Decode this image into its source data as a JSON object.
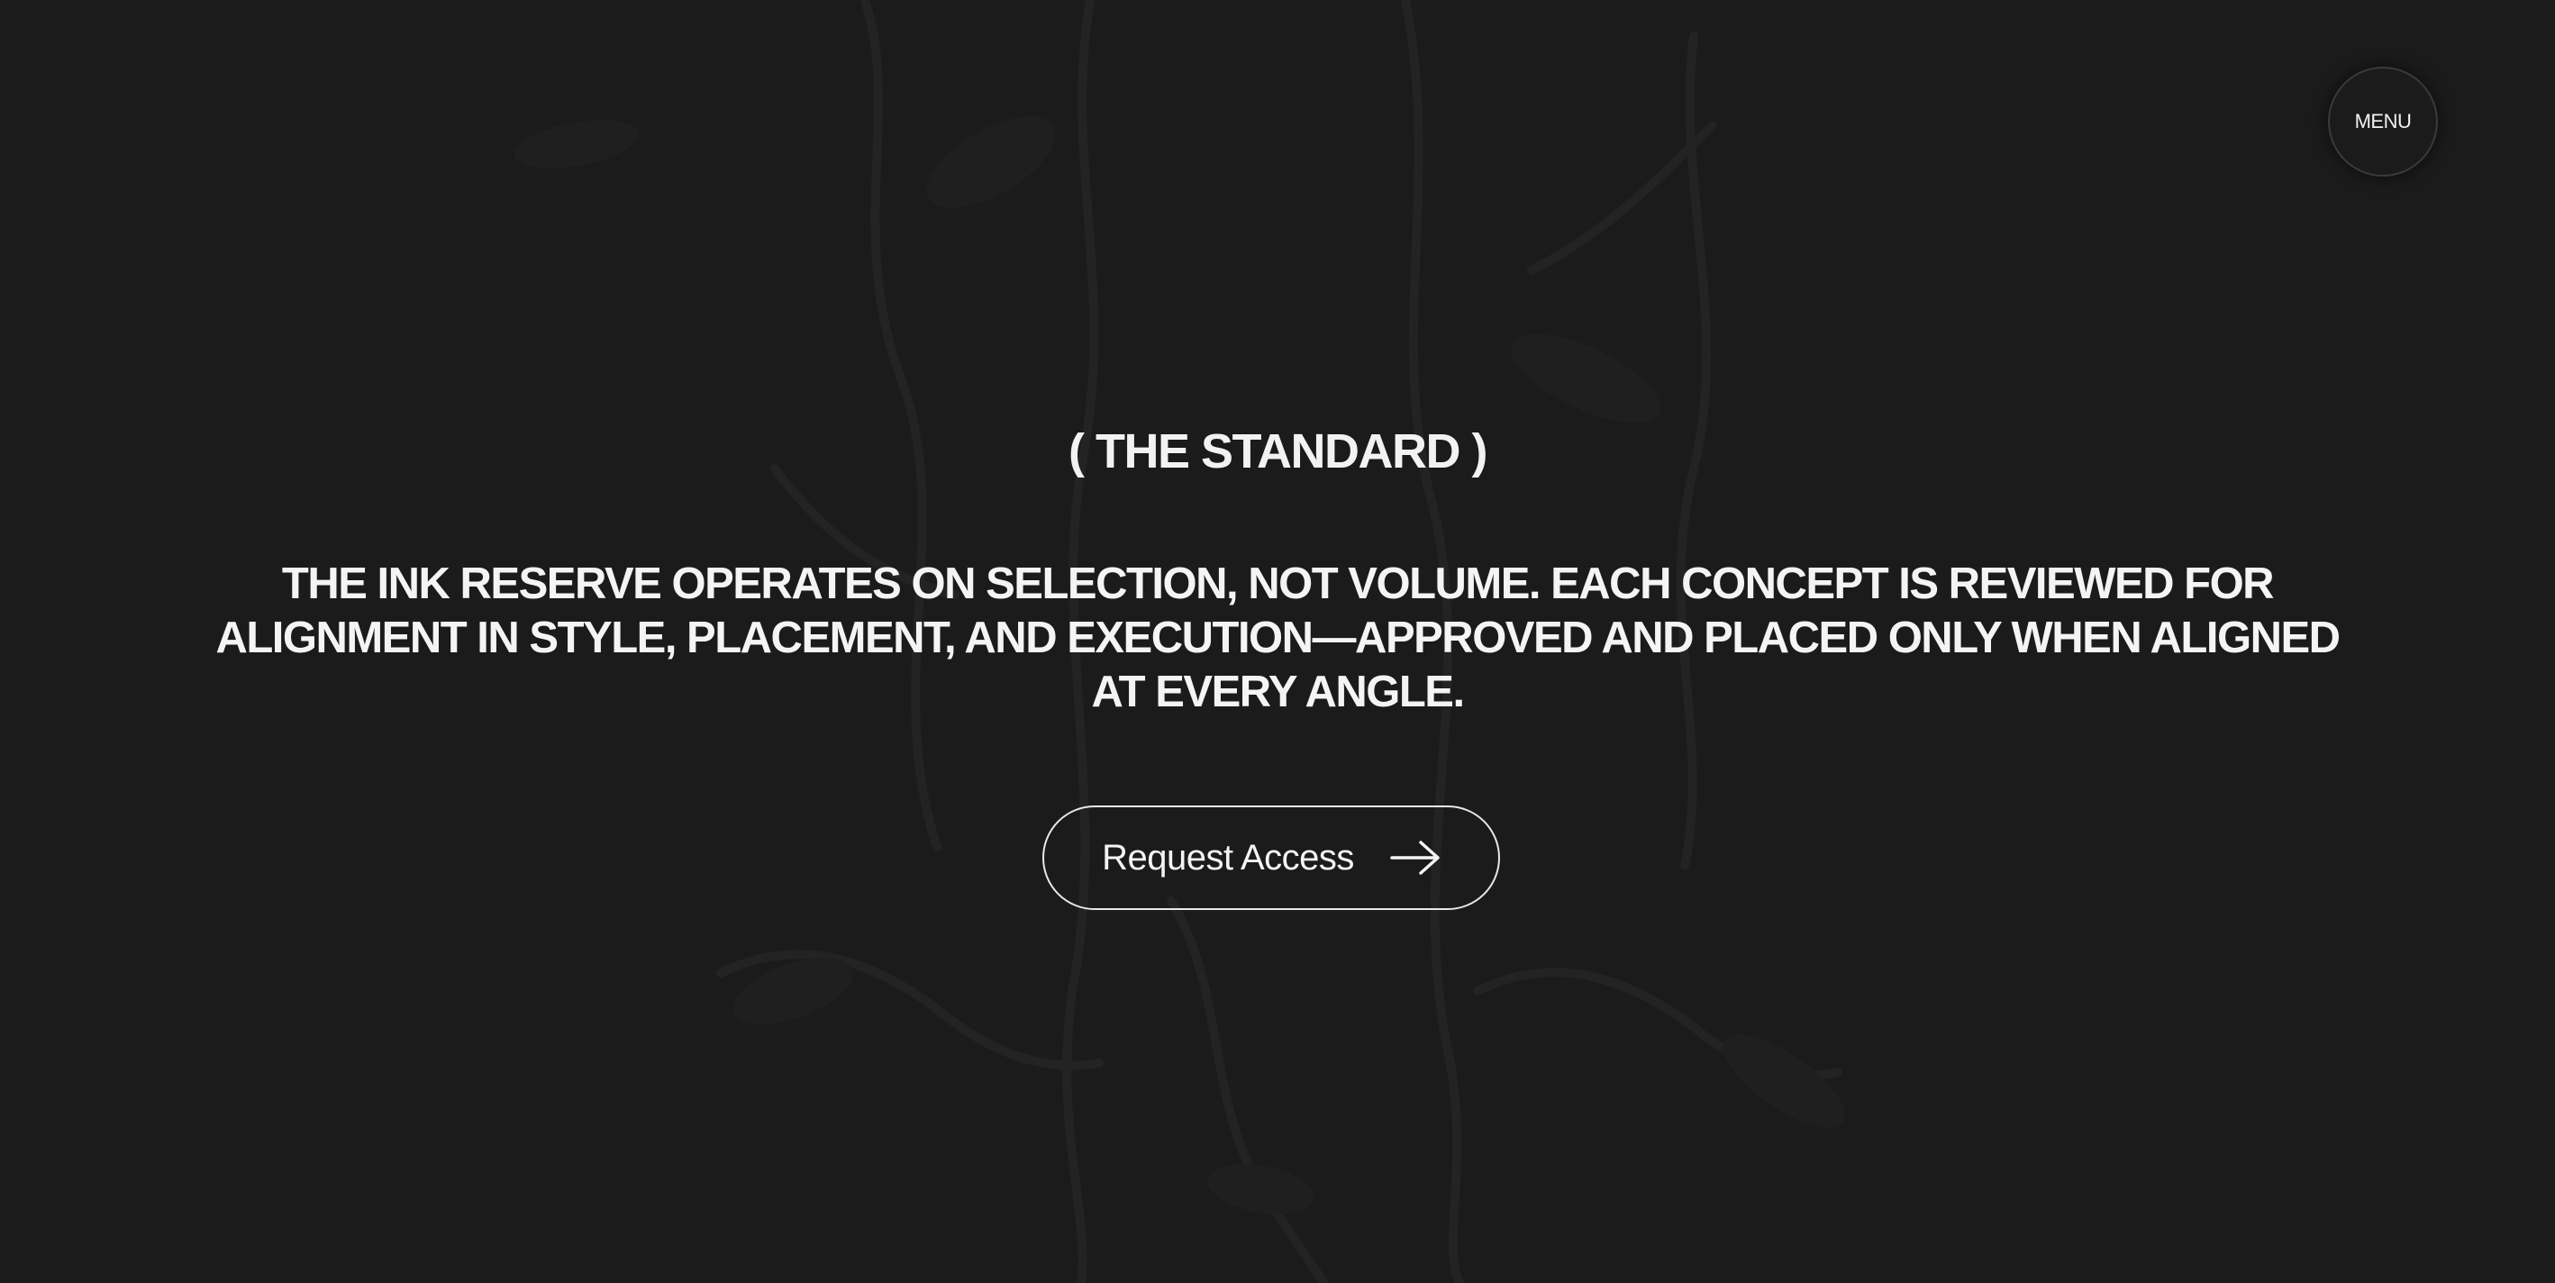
{
  "header": {
    "menu_label": "MENU"
  },
  "hero": {
    "eyebrow": "( THE STANDARD )",
    "statement": "THE INK RESERVE OPERATES ON SELECTION, NOT VOLUME. EACH CONCEPT IS REVIEWED FOR ALIGNMENT IN STYLE, PLACEMENT, AND EXECUTION—APPROVED AND PLACED ONLY WHEN ALIGNED AT EVERY ANGLE.",
    "cta_label": "Request Access",
    "cta_icon": "arrow-right-icon"
  },
  "colors": {
    "background": "#1b1b1b",
    "text": "#f4f4f4",
    "art": "#2a2a2a"
  }
}
